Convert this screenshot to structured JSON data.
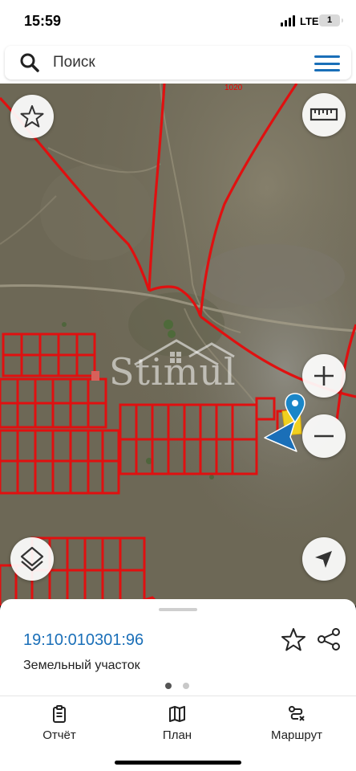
{
  "status_bar": {
    "time": "15:59",
    "network": "LTE",
    "battery": "1"
  },
  "search": {
    "placeholder": "Поиск",
    "icon": "search-icon",
    "menu_icon": "hamburger-menu-icon"
  },
  "map": {
    "road_label": "1020",
    "watermark": "Stimul",
    "parcel_color": "#e01010",
    "buttons": {
      "favorite": "star-icon",
      "ruler": "ruler-icon",
      "zoom_in": "plus-icon",
      "zoom_out": "minus-icon",
      "layers": "layers-icon",
      "locate": "navigation-arrow-icon"
    }
  },
  "sheet": {
    "parcel_id": "19:10:010301:96",
    "parcel_type": "Земельный участок",
    "page": 1,
    "pages": 2,
    "accent": "#1a6fb8"
  },
  "tabs": [
    {
      "label": "Отчёт",
      "icon": "report-clipboard-icon"
    },
    {
      "label": "План",
      "icon": "map-plan-icon"
    },
    {
      "label": "Маршрут",
      "icon": "route-icon"
    }
  ]
}
